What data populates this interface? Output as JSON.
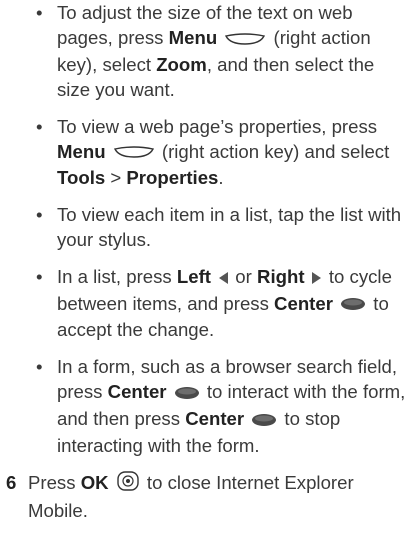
{
  "bullets": [
    {
      "parts": [
        {
          "t": "To adjust the size of the text on web pages, press "
        },
        {
          "b": "Menu"
        },
        {
          "icon": "menu-key-icon"
        },
        {
          "t": " (right action key), select "
        },
        {
          "b": "Zoom"
        },
        {
          "t": ", and then select the size you want."
        }
      ]
    },
    {
      "parts": [
        {
          "t": "To view a web page’s properties, press "
        },
        {
          "b": "Menu"
        },
        {
          "icon": "menu-key-icon"
        },
        {
          "t": " (right action key) and select "
        },
        {
          "b": "Tools"
        },
        {
          "t": " > "
        },
        {
          "b": "Properties"
        },
        {
          "t": "."
        }
      ]
    },
    {
      "parts": [
        {
          "t": "To view each item in a list, tap the list with your stylus."
        }
      ]
    },
    {
      "parts": [
        {
          "t": "In a list, press "
        },
        {
          "b": "Left"
        },
        {
          "icon": "left-arrow-icon"
        },
        {
          "t": " or "
        },
        {
          "b": "Right"
        },
        {
          "icon": "right-arrow-icon"
        },
        {
          "t": " to cycle between items, and press "
        },
        {
          "b": "Center"
        },
        {
          "icon": "center-key-icon"
        },
        {
          "t": " to accept the change."
        }
      ]
    },
    {
      "parts": [
        {
          "t": "In a form, such as a browser search field, press "
        },
        {
          "b": "Center"
        },
        {
          "icon": "center-key-icon"
        },
        {
          "t": " to interact with the form, and then press "
        },
        {
          "b": "Center"
        },
        {
          "icon": "center-key-icon"
        },
        {
          "t": " to stop interacting with the form."
        }
      ]
    }
  ],
  "step": {
    "number": "6",
    "parts": [
      {
        "t": "Press "
      },
      {
        "b": "OK"
      },
      {
        "icon": "ok-key-icon"
      },
      {
        "t": " to close Internet Explorer Mobile."
      }
    ]
  },
  "bullet_glyph": "•"
}
